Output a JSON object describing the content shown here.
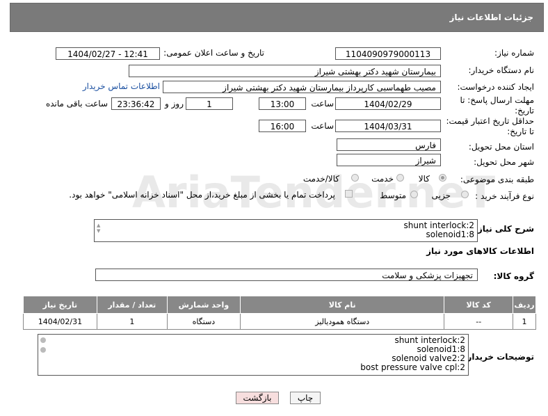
{
  "panel": {
    "title": "جزئیات اطلاعات نیاز"
  },
  "form": {
    "need_number_label": "شماره نیاز:",
    "need_number": "1104090979000113",
    "announce_label": "تاریخ و ساعت اعلان عمومی:",
    "announce_value": "1404/02/27 - 12:41",
    "buyer_label": "نام دستگاه خریدار:",
    "buyer_value": "بیمارستان شهید دکتر بهشتی شیراز",
    "creator_label": "ایجاد کننده درخواست:",
    "creator_value": "مصیب طهماسبی کارپرداز بیمارستان شهید دکتر بهشتی شیراز",
    "contact_link": "اطلاعات تماس خریدار",
    "deadline_label": "مهلت ارسال پاسخ: تا تاریخ:",
    "deadline_date": "1404/02/29",
    "time_label": "ساعت",
    "deadline_time": "13:00",
    "days_value": "1",
    "days_label": "روز و",
    "remaining_value": "23:36:42",
    "remaining_label": "ساعت باقی مانده",
    "validity_label": "حداقل تاریخ اعتبار قیمت: تا تاریخ:",
    "validity_date": "1404/03/31",
    "validity_time": "16:00",
    "province_label": "استان محل تحویل:",
    "province_value": "فارس",
    "city_label": "شهر محل تحویل:",
    "city_value": "شیراز",
    "category_label": "طبقه بندی موضوعی:",
    "category_options": [
      "کالا",
      "خدمت",
      "کالا/خدمت"
    ],
    "process_label": "نوع فرآیند خرید :",
    "process_options": [
      "جزیی",
      "متوسط"
    ],
    "payment_note": "پرداخت تمام یا بخشی از مبلغ خرید،از محل \"اسناد خزانه اسلامی\" خواهد بود.",
    "summary_label": "شرح کلی نیاز:",
    "summary_lines": [
      "shunt interlock:2",
      "solenoid1:8"
    ]
  },
  "goods": {
    "section_title": "اطلاعات کالاهای مورد نیاز",
    "group_label": "گروه کالا:",
    "group_value": "تجهیزات پزشکی و سلامت",
    "columns": [
      "ردیف",
      "کد کالا",
      "نام کالا",
      "واحد شمارش",
      "تعداد / مقدار",
      "تاریخ نیاز"
    ],
    "rows": [
      [
        "1",
        "--",
        "دستگاه همودیالیز",
        "دستگاه",
        "1",
        "1404/02/31"
      ]
    ]
  },
  "buyer_notes": {
    "label": "توضیحات خریدار:",
    "lines": [
      "shunt interlock:2",
      "solenoid1:8",
      "solenoid valve2:2",
      "bost pressure valve cpl:2"
    ]
  },
  "buttons": {
    "print": "چاپ",
    "back": "بازگشت"
  },
  "watermark": {
    "text": "AriaTender.neT"
  },
  "colors": {
    "header_bg": "#7a7a7a",
    "link": "#1a4fa0",
    "back_button_bg": "#f7dede"
  }
}
